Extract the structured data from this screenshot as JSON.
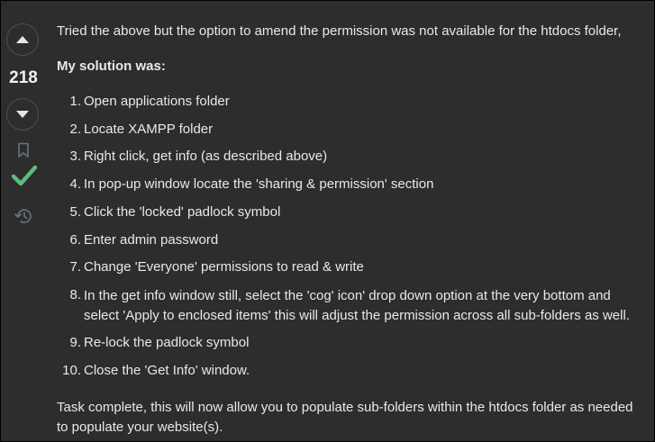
{
  "vote": {
    "score": "218",
    "upvote_label": "Upvote",
    "downvote_label": "Downvote",
    "icons": [
      "chevron-up-icon",
      "chevron-down-icon",
      "bookmark-icon",
      "checkmark-icon",
      "history-icon"
    ]
  },
  "answer": {
    "intro": "Tried the above but the option to amend the permission was not available for the htdocs folder,",
    "solution_heading": "My solution was:",
    "steps": [
      {
        "num": "1.",
        "text": "Open applications folder"
      },
      {
        "num": "2.",
        "text": "Locate XAMPP folder"
      },
      {
        "num": "3.",
        "text": "Right click, get info (as described above)"
      },
      {
        "num": "4.",
        "text": "In pop-up window locate the 'sharing & permission' section"
      },
      {
        "num": "5.",
        "text": "Click the 'locked' padlock symbol"
      },
      {
        "num": "6.",
        "text": "Enter admin password"
      },
      {
        "num": "7.",
        "text": "Change 'Everyone' permissions to read & write"
      },
      {
        "num": "8.",
        "text": "In the get info window still, select the 'cog' icon' drop down option at the very bottom and select 'Apply to enclosed items' this will adjust the permission across all sub-folders as well."
      },
      {
        "num": "9.",
        "text": "Re-lock the padlock symbol"
      },
      {
        "num": "10.",
        "text": "Close the 'Get Info' window."
      }
    ],
    "conclusion": "Task complete, this will now allow you to populate sub-folders within the htdocs folder as needed to populate your website(s)."
  },
  "colors": {
    "background": "#2d2d2d",
    "text": "#e7e9eb",
    "accepted": "#5eba7d",
    "muted_icon": "#6a737c"
  }
}
